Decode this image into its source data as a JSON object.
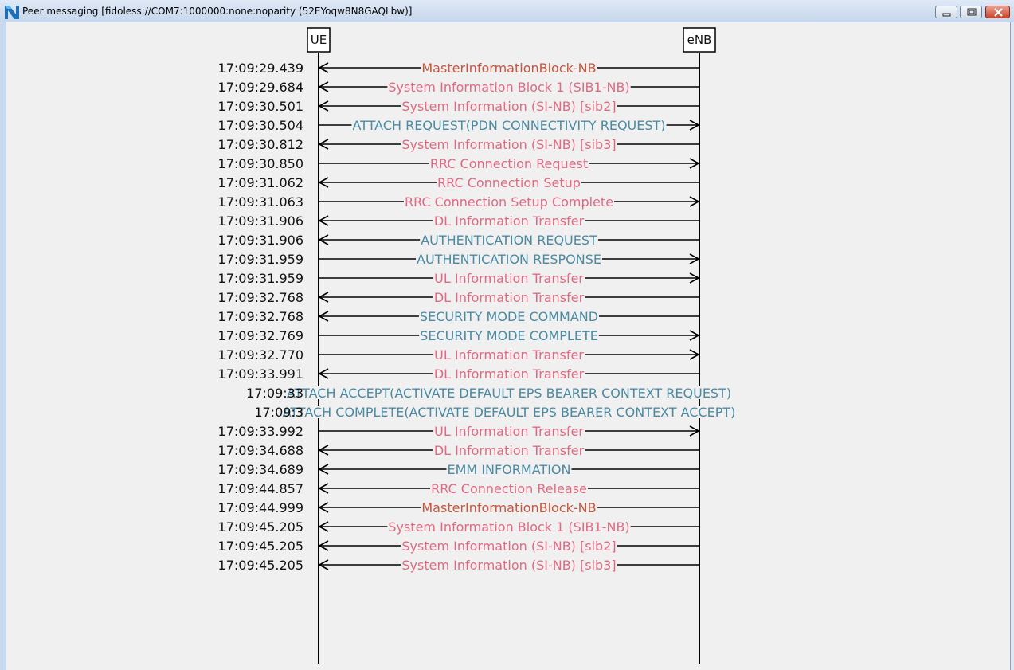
{
  "window": {
    "title": "Peer messaging [fidoless://COM7:1000000:none:noparity (52EYoqw8N8GAQLbw)]",
    "icon": "app-logo-icon",
    "buttons": [
      "minimize-icon",
      "maximize-icon",
      "close-icon"
    ]
  },
  "entities": {
    "ue": "UE",
    "enb": "eNB"
  },
  "colors": {
    "rrc": "#e06a82",
    "nas": "#4a8aa3",
    "mib": "#c8553d",
    "line": "#000000",
    "timestamp": "#111111"
  },
  "messages": [
    {
      "time": "17:09:29.439",
      "label": "MasterInformationBlock-NB",
      "dir": "to_ue",
      "kind": "mib"
    },
    {
      "time": "17:09:29.684",
      "label": "System Information Block 1 (SIB1-NB)",
      "dir": "to_ue",
      "kind": "rrc"
    },
    {
      "time": "17:09:30.501",
      "label": "System Information (SI-NB) [sib2]",
      "dir": "to_ue",
      "kind": "rrc"
    },
    {
      "time": "17:09:30.504",
      "label": "ATTACH REQUEST(PDN CONNECTIVITY REQUEST)",
      "dir": "to_enb",
      "kind": "nas"
    },
    {
      "time": "17:09:30.812",
      "label": "System Information (SI-NB) [sib3]",
      "dir": "to_ue",
      "kind": "rrc"
    },
    {
      "time": "17:09:30.850",
      "label": "RRC Connection Request",
      "dir": "to_enb",
      "kind": "rrc"
    },
    {
      "time": "17:09:31.062",
      "label": "RRC Connection Setup",
      "dir": "to_ue",
      "kind": "rrc"
    },
    {
      "time": "17:09:31.063",
      "label": "RRC Connection Setup Complete",
      "dir": "to_enb",
      "kind": "rrc"
    },
    {
      "time": "17:09:31.906",
      "label": "DL Information Transfer",
      "dir": "to_ue",
      "kind": "rrc"
    },
    {
      "time": "17:09:31.906",
      "label": "AUTHENTICATION REQUEST",
      "dir": "to_ue",
      "kind": "nas"
    },
    {
      "time": "17:09:31.959",
      "label": "AUTHENTICATION RESPONSE",
      "dir": "to_enb",
      "kind": "nas"
    },
    {
      "time": "17:09:31.959",
      "label": "UL Information Transfer",
      "dir": "to_enb",
      "kind": "rrc"
    },
    {
      "time": "17:09:32.768",
      "label": "DL Information Transfer",
      "dir": "to_ue",
      "kind": "rrc"
    },
    {
      "time": "17:09:32.768",
      "label": "SECURITY MODE COMMAND",
      "dir": "to_ue",
      "kind": "nas"
    },
    {
      "time": "17:09:32.769",
      "label": "SECURITY MODE COMPLETE",
      "dir": "to_enb",
      "kind": "nas"
    },
    {
      "time": "17:09:32.770",
      "label": "UL Information Transfer",
      "dir": "to_enb",
      "kind": "rrc"
    },
    {
      "time": "17:09:33.991",
      "label": "DL Information Transfer",
      "dir": "to_ue",
      "kind": "rrc"
    },
    {
      "time": "17:09:33",
      "label": "ATTACH ACCEPT(ACTIVATE DEFAULT EPS BEARER CONTEXT REQUEST)",
      "dir": "to_ue",
      "kind": "nas"
    },
    {
      "time": "17:09:3",
      "label": "ATTACH COMPLETE(ACTIVATE DEFAULT EPS BEARER CONTEXT ACCEPT)",
      "dir": "to_enb",
      "kind": "nas"
    },
    {
      "time": "17:09:33.992",
      "label": "UL Information Transfer",
      "dir": "to_enb",
      "kind": "rrc"
    },
    {
      "time": "17:09:34.688",
      "label": "DL Information Transfer",
      "dir": "to_ue",
      "kind": "rrc"
    },
    {
      "time": "17:09:34.689",
      "label": "EMM INFORMATION",
      "dir": "to_ue",
      "kind": "nas"
    },
    {
      "time": "17:09:44.857",
      "label": "RRC Connection Release",
      "dir": "to_ue",
      "kind": "rrc"
    },
    {
      "time": "17:09:44.999",
      "label": "MasterInformationBlock-NB",
      "dir": "to_ue",
      "kind": "mib"
    },
    {
      "time": "17:09:45.205",
      "label": "System Information Block 1 (SIB1-NB)",
      "dir": "to_ue",
      "kind": "rrc"
    },
    {
      "time": "17:09:45.205",
      "label": "System Information (SI-NB) [sib2]",
      "dir": "to_ue",
      "kind": "rrc"
    },
    {
      "time": "17:09:45.205",
      "label": "System Information (SI-NB) [sib3]",
      "dir": "to_ue",
      "kind": "rrc"
    }
  ]
}
